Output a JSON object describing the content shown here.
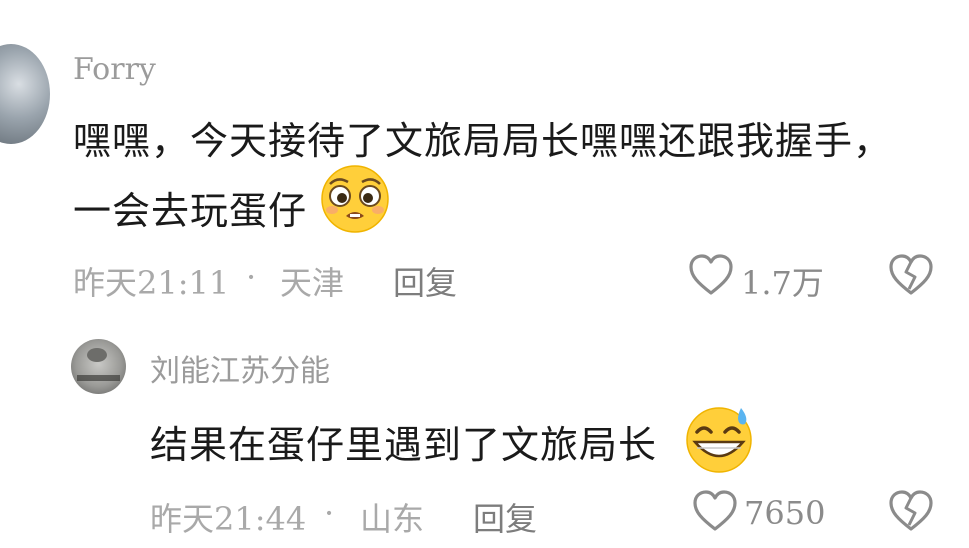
{
  "comments": [
    {
      "username": "Forry",
      "text_line1": "嘿嘿，今天接待了文旅局局长嘿嘿还跟我握手，",
      "text_line2": "一会去玩蛋仔",
      "emoji": "pleading-face-emoji",
      "time": "昨天21:11",
      "separator": "·",
      "location": "天津",
      "reply_label": "回复",
      "like_count": "1.7万"
    },
    {
      "username": "刘能江苏分能",
      "text": "结果在蛋仔里遇到了文旅局长",
      "emoji": "grinning-sweat-emoji",
      "time": "昨天21:44",
      "separator": "·",
      "location": "山东",
      "reply_label": "回复",
      "like_count": "7650"
    }
  ],
  "icons": {
    "like": "heart-outline-icon",
    "dislike": "broken-heart-icon"
  },
  "colors": {
    "text": "#1a1a1a",
    "muted": "#a9a9a9",
    "icon": "#8b8b8b",
    "emoji_yellow": "#ffcf3a"
  }
}
